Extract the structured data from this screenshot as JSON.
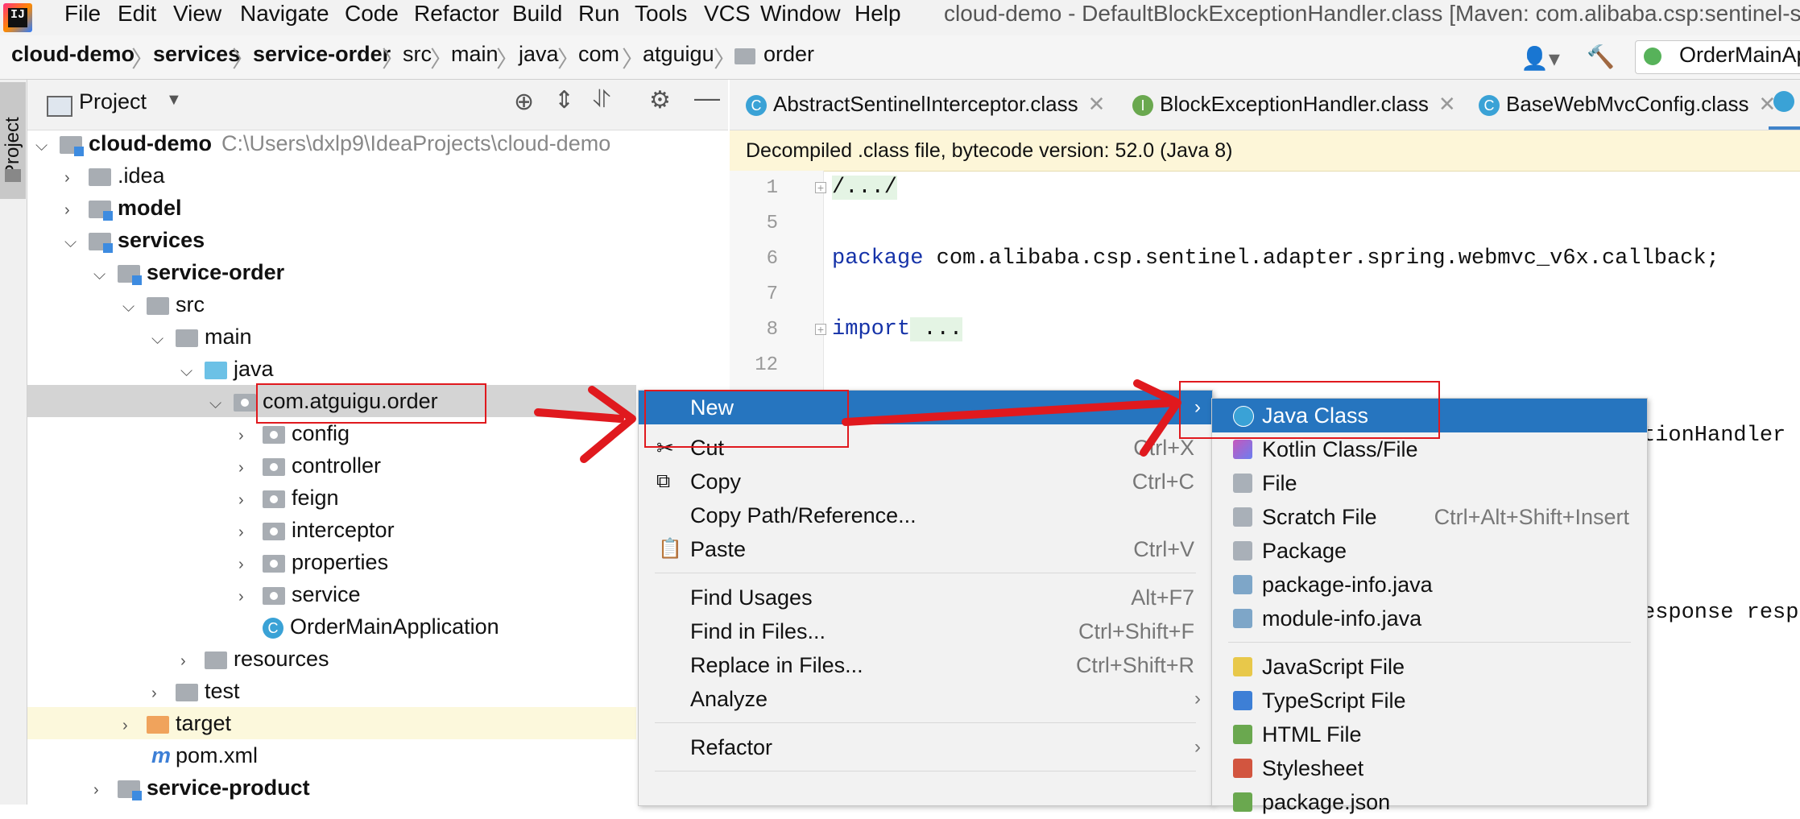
{
  "menubar": {
    "logo_text": "IJ",
    "items": [
      "File",
      "Edit",
      "View",
      "Navigate",
      "Code",
      "Refactor",
      "Build",
      "Run",
      "Tools",
      "VCS",
      "Window",
      "Help"
    ],
    "window_title": "cloud-demo - DefaultBlockExceptionHandler.class [Maven: com.alibaba.csp:sentinel-spring-w"
  },
  "breadcrumb": {
    "items": [
      "cloud-demo",
      "services",
      "service-order",
      "src",
      "main",
      "java",
      "com",
      "atguigu",
      "order"
    ],
    "run_config": "OrderMainAp"
  },
  "side_tab": "Project",
  "project_panel": {
    "title": "Project",
    "tree": [
      {
        "label": "cloud-demo",
        "path": "C:\\Users\\dxlp9\\IdeaProjects\\cloud-demo"
      },
      {
        "label": ".idea"
      },
      {
        "label": "model"
      },
      {
        "label": "services"
      },
      {
        "label": "service-order"
      },
      {
        "label": "src"
      },
      {
        "label": "main"
      },
      {
        "label": "java"
      },
      {
        "label": "com.atguigu.order"
      },
      {
        "label": "config"
      },
      {
        "label": "controller"
      },
      {
        "label": "feign"
      },
      {
        "label": "interceptor"
      },
      {
        "label": "properties"
      },
      {
        "label": "service"
      },
      {
        "label": "OrderMainApplication"
      },
      {
        "label": "resources"
      },
      {
        "label": "test"
      },
      {
        "label": "target"
      },
      {
        "label": "pom.xml"
      },
      {
        "label": "service-product"
      }
    ]
  },
  "editor": {
    "tabs": [
      "AbstractSentinelInterceptor.class",
      "BlockExceptionHandler.class",
      "BaseWebMvcConfig.class"
    ],
    "banner": "Decompiled .class file, bytecode version: 52.0 (Java 8)",
    "lines": [
      {
        "num": "1",
        "text": "/.../"
      },
      {
        "num": "5",
        "text": ""
      },
      {
        "num": "6",
        "kw": "package",
        "text": " com.alibaba.csp.sentinel.adapter.spring.webmvc_v6x.callback;"
      },
      {
        "num": "7",
        "text": ""
      },
      {
        "num": "8",
        "kw": "import",
        "text": " ..."
      },
      {
        "num": "12",
        "text": ""
      }
    ],
    "partial_right_1": "tionHandler",
    "partial_right_2": "esponse resp"
  },
  "context_menu": {
    "items": [
      {
        "label": "New",
        "shortcut": ""
      },
      {
        "label": "Cut",
        "shortcut": "Ctrl+X"
      },
      {
        "label": "Copy",
        "shortcut": "Ctrl+C"
      },
      {
        "label": "Copy Path/Reference...",
        "shortcut": ""
      },
      {
        "label": "Paste",
        "shortcut": "Ctrl+V"
      },
      {
        "label": "Find Usages",
        "shortcut": "Alt+F7"
      },
      {
        "label": "Find in Files...",
        "shortcut": "Ctrl+Shift+F"
      },
      {
        "label": "Replace in Files...",
        "shortcut": "Ctrl+Shift+R"
      },
      {
        "label": "Analyze",
        "shortcut": ""
      },
      {
        "label": "Refactor",
        "shortcut": ""
      }
    ]
  },
  "new_submenu": {
    "items": [
      {
        "label": "Java Class",
        "shortcut": ""
      },
      {
        "label": "Kotlin Class/File",
        "shortcut": ""
      },
      {
        "label": "File",
        "shortcut": ""
      },
      {
        "label": "Scratch File",
        "shortcut": "Ctrl+Alt+Shift+Insert"
      },
      {
        "label": "Package",
        "shortcut": ""
      },
      {
        "label": "package-info.java",
        "shortcut": ""
      },
      {
        "label": "module-info.java",
        "shortcut": ""
      },
      {
        "label": "JavaScript File",
        "shortcut": ""
      },
      {
        "label": "TypeScript File",
        "shortcut": ""
      },
      {
        "label": "HTML File",
        "shortcut": ""
      },
      {
        "label": "Stylesheet",
        "shortcut": ""
      },
      {
        "label": "package.json",
        "shortcut": ""
      }
    ]
  },
  "colors": {
    "selection": "#2675bf",
    "annotation": "#e0191e",
    "banner": "#fdf6d8"
  }
}
